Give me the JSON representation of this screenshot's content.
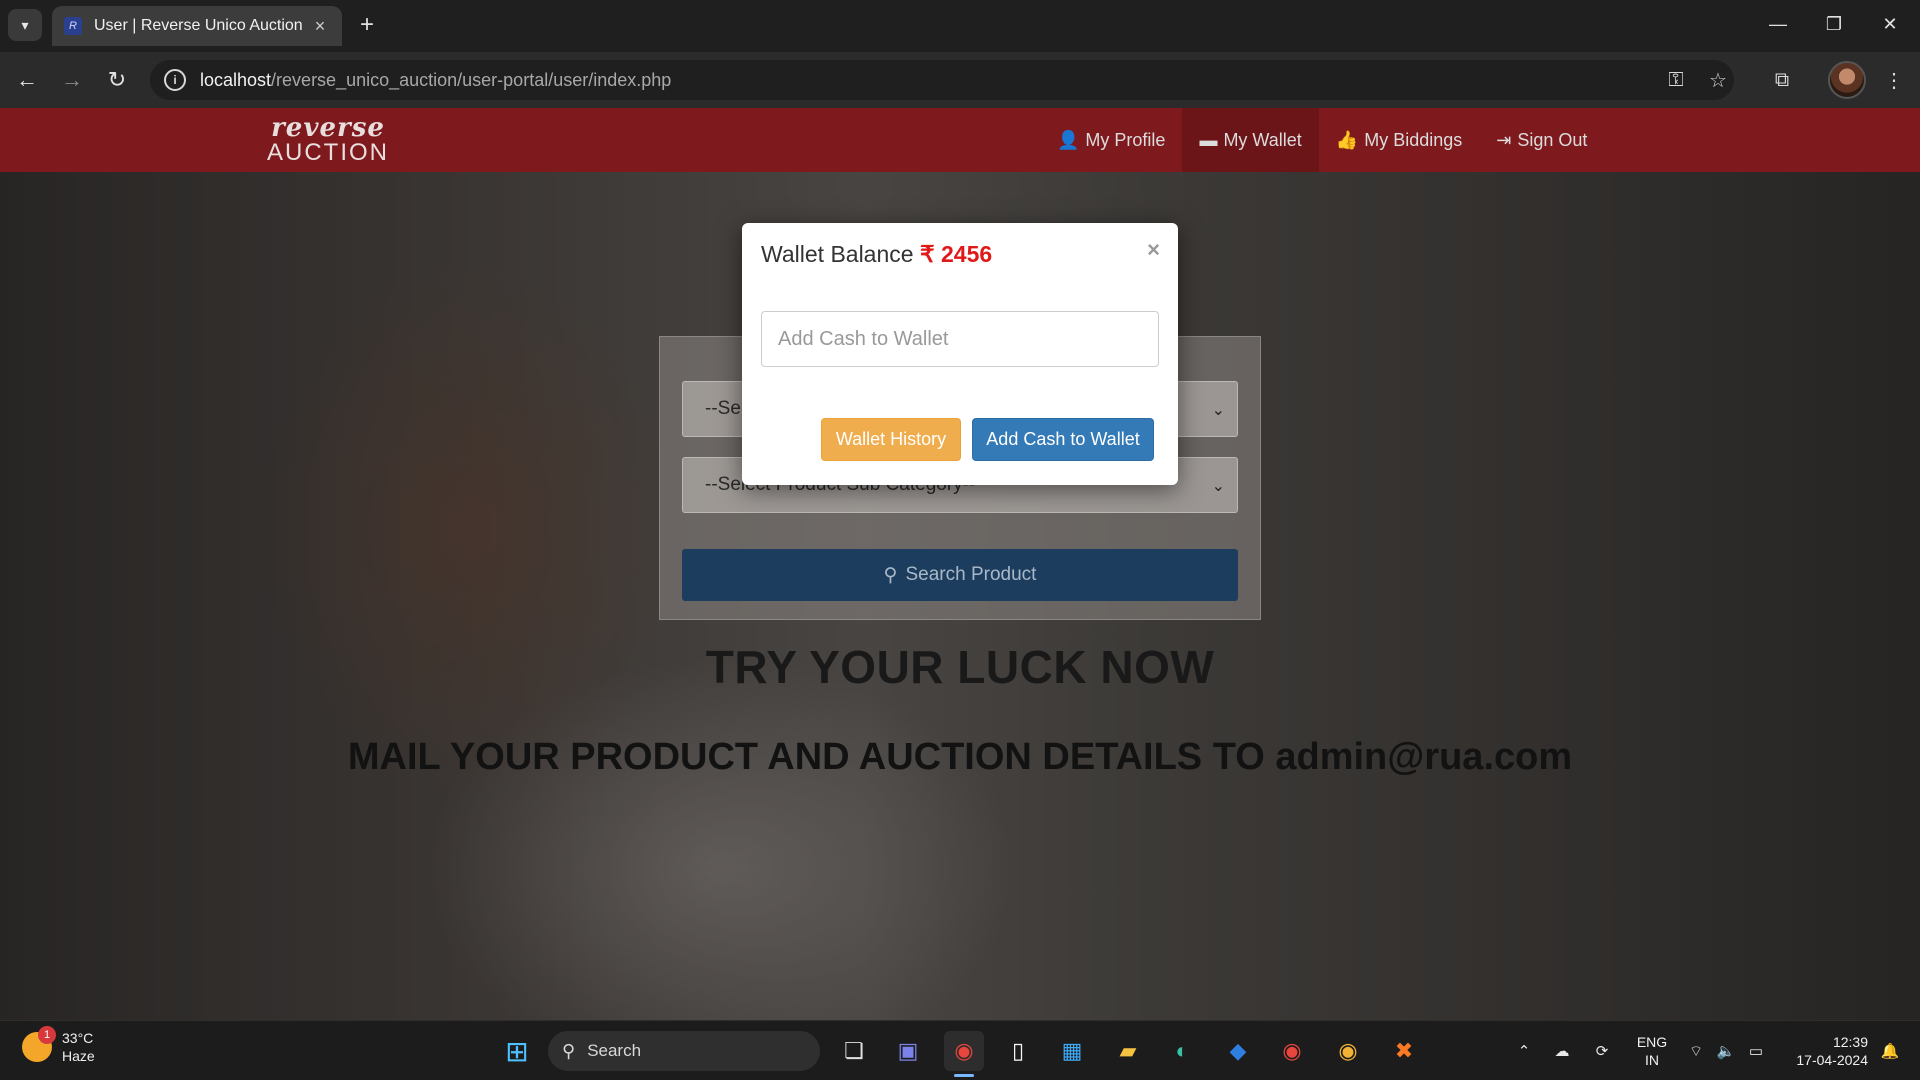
{
  "browser": {
    "tab_title": "User | Reverse Unico Auction",
    "url_host": "localhost",
    "url_path": "/reverse_unico_auction/user-portal/user/index.php"
  },
  "site": {
    "brand_top": "reverse",
    "brand_bottom": "AUCTION",
    "nav": [
      {
        "label": "My Profile",
        "icon": "user-icon"
      },
      {
        "label": "My Wallet",
        "icon": "wallet-icon",
        "active": true
      },
      {
        "label": "My Biddings",
        "icon": "thumbs-up-icon"
      },
      {
        "label": "Sign Out",
        "icon": "sign-out-icon"
      }
    ]
  },
  "search": {
    "category_select": "--Se",
    "subcategory_select": "--Select Product Sub Category--",
    "search_button": "Search Product"
  },
  "hero": {
    "headline": "TRY YOUR LUCK NOW",
    "mail_line": "MAIL YOUR PRODUCT AND AUCTION DETAILS TO admin@rua.com"
  },
  "modal": {
    "title": "Wallet Balance",
    "currency": "₹",
    "balance": "2456",
    "close": "×",
    "input_placeholder": "Add Cash to Wallet",
    "history_button": "Wallet History",
    "add_button": "Add Cash to Wallet"
  },
  "taskbar": {
    "weather_temp": "33°C",
    "weather_desc": "Haze",
    "weather_badge": "1",
    "search_label": "Search",
    "lang_top": "ENG",
    "lang_bottom": "IN",
    "time": "12:39",
    "date": "17-04-2024"
  },
  "colors": {
    "nav_red": "#7e1a1e",
    "balance_red": "#e01818",
    "warning": "#f0ad4e",
    "primary": "#337ab7",
    "search_blue": "#1c3d5e"
  }
}
